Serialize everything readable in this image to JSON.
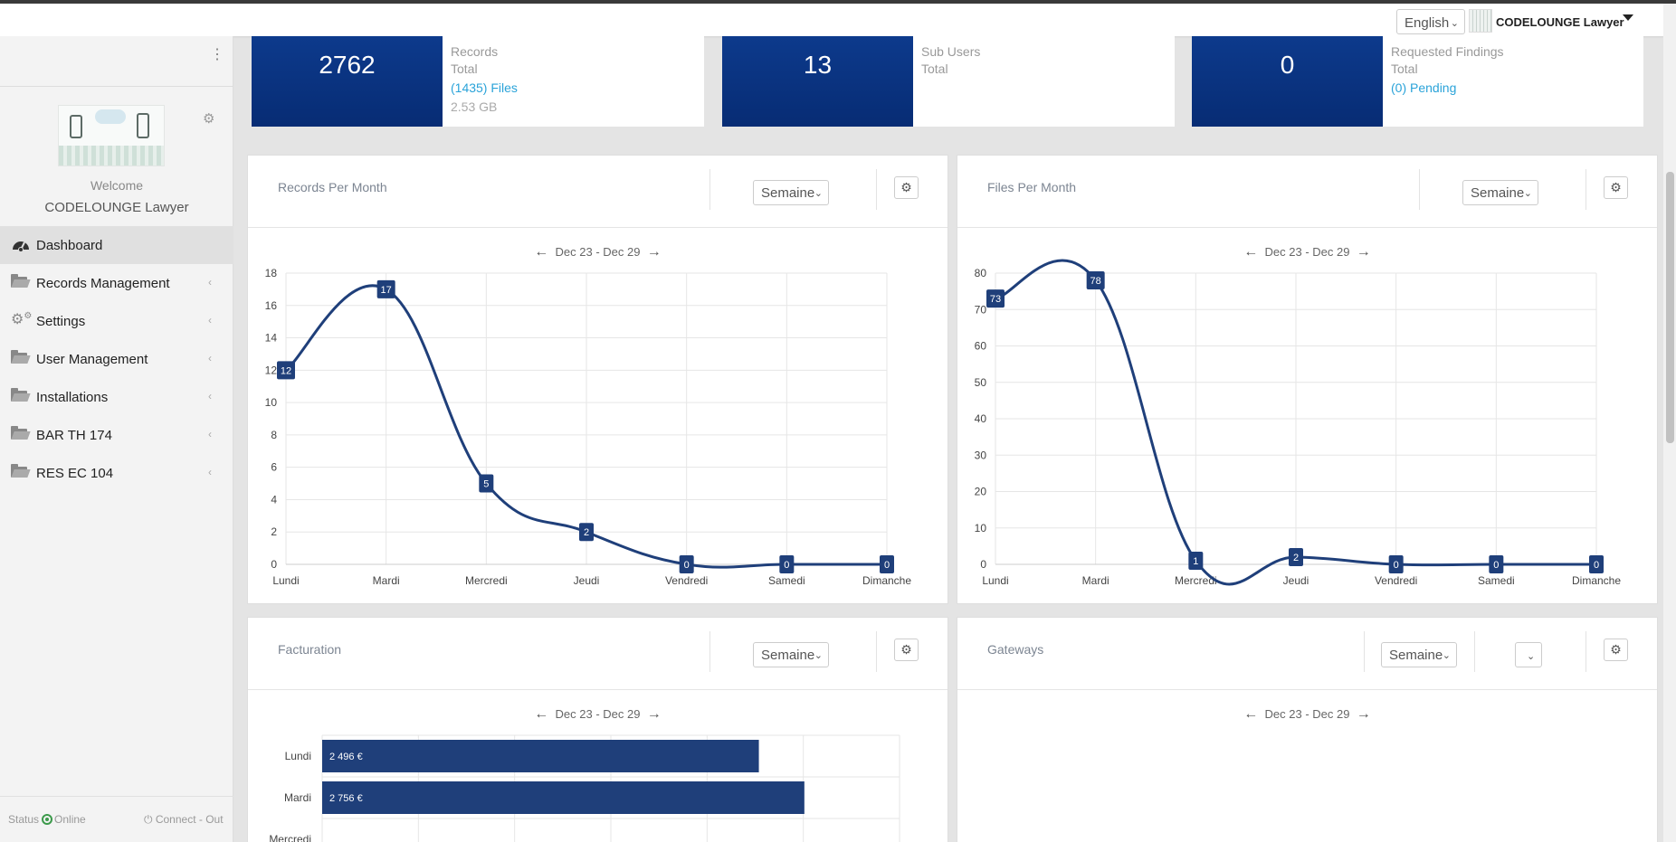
{
  "topbar": {
    "language": "English",
    "user_name": "CODELOUNGE Lawyer"
  },
  "sidebar": {
    "welcome": "Welcome",
    "user": "CODELOUNGE Lawyer",
    "items": [
      {
        "label": "Dashboard",
        "icon": "dashboard-icon",
        "active": true
      },
      {
        "label": "Records Management",
        "icon": "folder-icon"
      },
      {
        "label": "Settings",
        "icon": "cogs-icon"
      },
      {
        "label": "User Management",
        "icon": "folder-icon"
      },
      {
        "label": "Installations",
        "icon": "folder-icon"
      },
      {
        "label": "BAR TH 174",
        "icon": "folder-icon"
      },
      {
        "label": "RES EC 104",
        "icon": "folder-icon"
      }
    ],
    "status_label": "Status",
    "status_value": "Online",
    "connect_label": "Connect - Out",
    "status_color": "#3c9a4b"
  },
  "stats": [
    {
      "value": "2762",
      "l1": "Records",
      "l2": "Total",
      "l3": "(1435) Files",
      "l4": "2.53 GB"
    },
    {
      "value": "13",
      "l1": "Sub Users",
      "l2": "Total"
    },
    {
      "value": "0",
      "l1": "Requested Findings",
      "l2": "Total",
      "l3": "(0) Pending"
    }
  ],
  "panels": {
    "records": {
      "title": "Records Per Month",
      "period": "Semaine",
      "range": "Dec 23 - Dec 29"
    },
    "files": {
      "title": "Files Per Month",
      "period": "Semaine",
      "range": "Dec 23 - Dec 29"
    },
    "billing": {
      "title": "Facturation",
      "period": "Semaine",
      "range": "Dec 23 - Dec 29"
    },
    "gateways": {
      "title": "Gateways",
      "period": "Semaine",
      "range": "Dec 23 - Dec 29"
    }
  },
  "arrows": {
    "left": "←",
    "right": "→"
  },
  "colors": {
    "accent": "#1f3f7a",
    "tile": "#0a3380",
    "link": "#2aa3d9"
  },
  "chart_data": [
    {
      "type": "line",
      "title": "Records Per Month",
      "categories": [
        "Lundi",
        "Mardi",
        "Mercredi",
        "Jeudi",
        "Vendredi",
        "Samedi",
        "Dimanche"
      ],
      "values": [
        12,
        17,
        5,
        2,
        0,
        0,
        0
      ],
      "ylim": [
        0,
        18
      ],
      "yticks": [
        0,
        2,
        4,
        6,
        8,
        10,
        12,
        14,
        16,
        18
      ],
      "grid": true
    },
    {
      "type": "line",
      "title": "Files Per Month",
      "categories": [
        "Lundi",
        "Mardi",
        "Mercredi",
        "Jeudi",
        "Vendredi",
        "Samedi",
        "Dimanche"
      ],
      "values": [
        73,
        78,
        1,
        2,
        0,
        0,
        0
      ],
      "ylim": [
        0,
        80
      ],
      "yticks": [
        0,
        10,
        20,
        30,
        40,
        50,
        60,
        70,
        80
      ],
      "grid": true
    },
    {
      "type": "bar",
      "orientation": "horizontal",
      "title": "Facturation",
      "categories": [
        "Lundi",
        "Mardi",
        "Mercredi"
      ],
      "values": [
        2496,
        2756,
        null
      ],
      "labels": [
        "2 496 €",
        "2 756 €",
        ""
      ],
      "xlim": [
        0,
        3300
      ],
      "grid": true
    }
  ]
}
